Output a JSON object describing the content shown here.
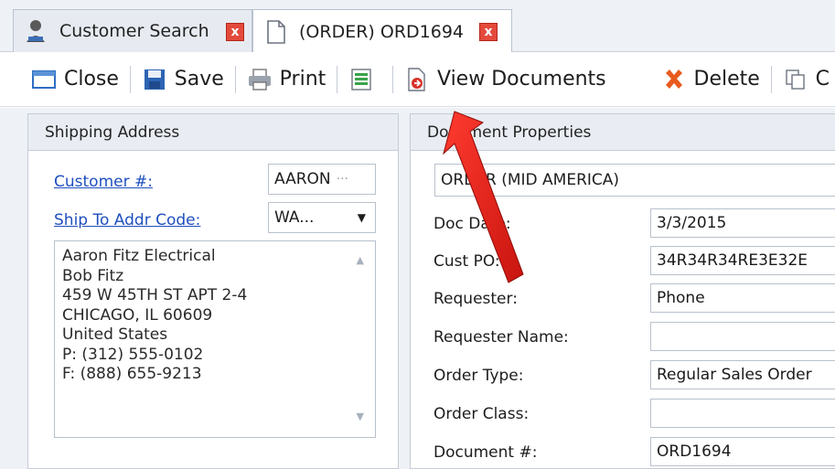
{
  "tabs": [
    {
      "label": "Customer Search",
      "icon": "user-search-icon",
      "close": "x"
    },
    {
      "label": "(ORDER) ORD1694",
      "icon": "document-icon",
      "close": "x"
    }
  ],
  "toolbar": {
    "close_label": "Close",
    "save_label": "Save",
    "print_label": "Print",
    "view_documents_label": "View Documents",
    "delete_label": "Delete",
    "copy_label": "C"
  },
  "shipping": {
    "header": "Shipping Address",
    "customer_label": "Customer #:",
    "customer_value": "AARON",
    "customer_more": "···",
    "shipto_label": "Ship To Addr Code:",
    "shipto_value": "WA...",
    "address_lines": [
      "Aaron Fitz Electrical",
      "Bob Fitz",
      "459 W 45TH ST APT 2-4",
      "CHICAGO, IL 60609",
      "United States",
      "P: (312) 555-0102",
      "F: (888) 655-9213"
    ]
  },
  "document": {
    "header": "Document Properties",
    "type_value": "ORDER (MID AMERICA)",
    "fields": [
      {
        "label": "Doc Date:",
        "value": "3/3/2015"
      },
      {
        "label": "Cust PO:",
        "value": "34R34R34RE3E32E"
      },
      {
        "label": "Requester:",
        "value": "Phone"
      },
      {
        "label": "Requester Name:",
        "value": ""
      },
      {
        "label": "Order Type:",
        "value": "Regular Sales Order"
      },
      {
        "label": "Order Class:",
        "value": ""
      },
      {
        "label": "Document #:",
        "value": "ORD1694"
      }
    ]
  },
  "colors": {
    "link": "#1f4fbf",
    "close_tab": "#e34a3c",
    "annotation_arrow": "#e0201b"
  }
}
